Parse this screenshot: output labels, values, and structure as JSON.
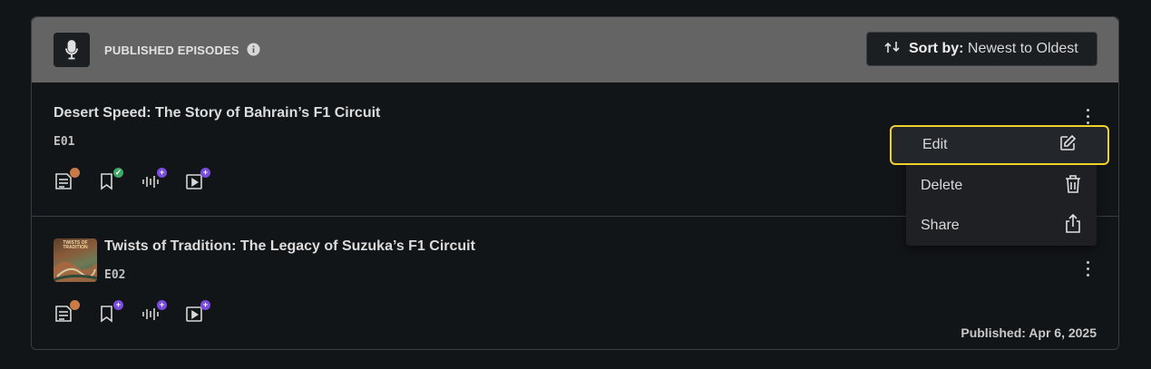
{
  "header": {
    "title": "PUBLISHED EPISODES",
    "mic_icon": "microphone-icon",
    "info_icon": "info-icon",
    "sort_label": "Sort by:",
    "sort_value": "Newest to Oldest"
  },
  "episodes": [
    {
      "title": "Desert Speed: The Story of Bahrain’s F1 Circuit",
      "code": "E01",
      "published": ""
    },
    {
      "title": "Twists of Tradition: The Legacy of Suzuka’s F1 Circuit",
      "code": "E02",
      "published": "Published: Apr 6, 2025",
      "thumbnail_text": "TWISTS OF TRADITION"
    }
  ],
  "menu": {
    "edit": "Edit",
    "delete": "Delete",
    "share": "Share"
  },
  "colors": {
    "header_bg": "#646464",
    "highlight": "#f2d02b",
    "badge_orange": "#c97a45",
    "badge_green": "#3ea86b",
    "badge_purple": "#7a4be0"
  }
}
